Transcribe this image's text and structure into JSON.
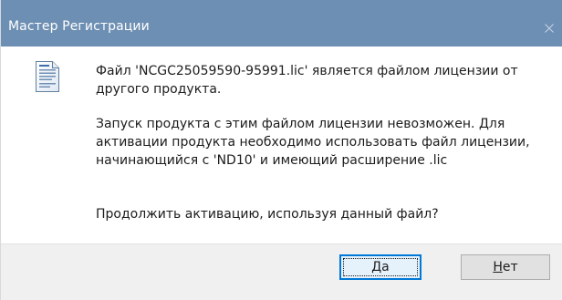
{
  "window": {
    "title": "Мастер Регистрации"
  },
  "icons": {
    "close": "close-icon",
    "document": "license-document-icon"
  },
  "message": {
    "line1": "Файл 'NCGC25059590-95991.lic' является файлом лицензии от",
    "line2": "другого продукта.",
    "line3": "Запуск продукта с этим файлом лицензии невозможен. Для",
    "line4": "активации продукта необходимо использовать файл лицензии,",
    "line5": "начинающийся с 'ND10' и имеющий расширение .lic",
    "question": "Продолжить активацию, используя данный файл?"
  },
  "buttons": {
    "yes": {
      "prefix": "",
      "hotkey": "Д",
      "suffix": "а"
    },
    "no": {
      "prefix": "",
      "hotkey": "Н",
      "suffix": "ет"
    }
  },
  "colors": {
    "titlebar": "#6d8fb3",
    "title_text": "#ffffff",
    "footer": "#f0f0f0",
    "default_button_border": "#0078d7"
  }
}
